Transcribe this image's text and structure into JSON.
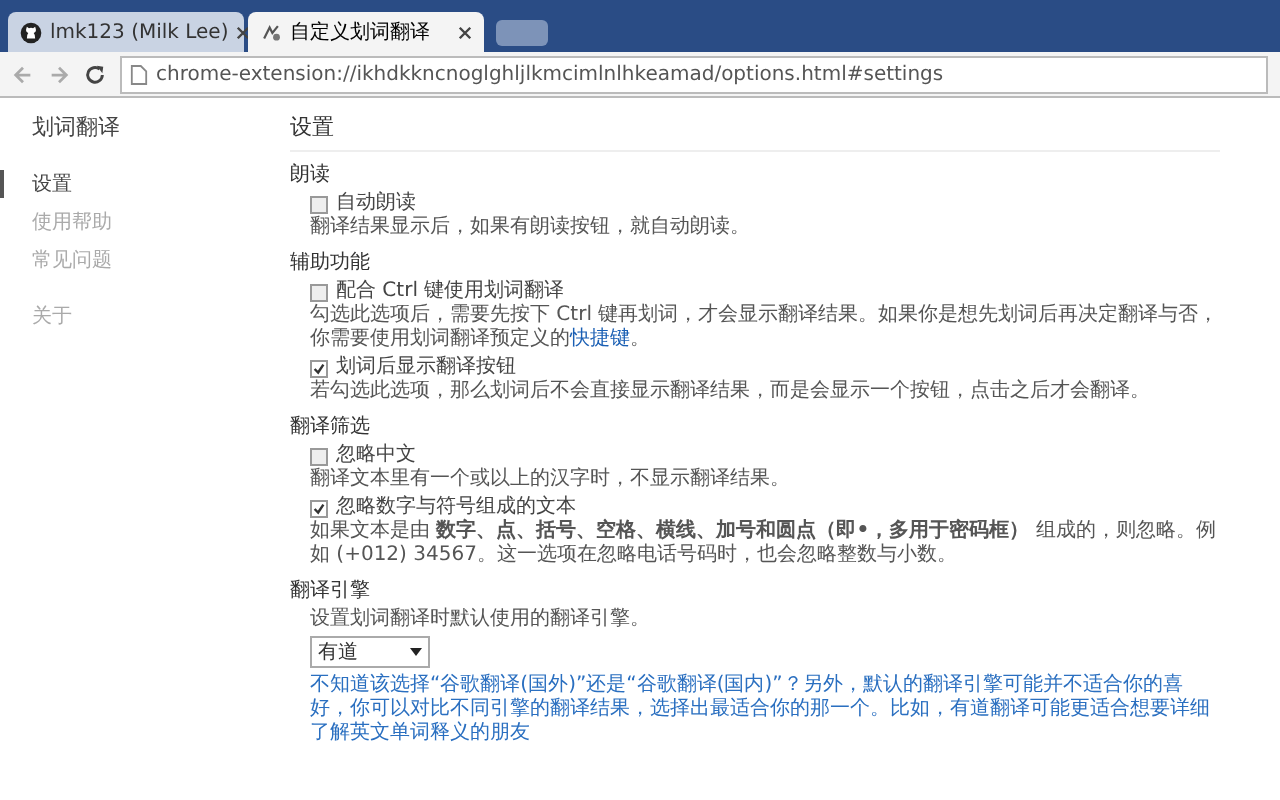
{
  "browser": {
    "tabs": [
      {
        "title": "lmk123 (Milk Lee)",
        "selected": false
      },
      {
        "title": "自定义划词翻译",
        "selected": true
      }
    ],
    "address": "chrome-extension://ikhdkkncnoglghljlkmcimlnlhkeamad/options.html#settings"
  },
  "sidebar": {
    "title": "划词翻译",
    "groups": [
      {
        "items": [
          {
            "label": "设置",
            "selected": true
          },
          {
            "label": "使用帮助",
            "selected": false
          },
          {
            "label": "常见问题",
            "selected": false
          }
        ]
      },
      {
        "items": [
          {
            "label": "关于",
            "selected": false
          }
        ]
      }
    ]
  },
  "page_title": "设置",
  "sections": [
    {
      "heading": "朗读",
      "items": [
        {
          "kind": "checkbox",
          "label": "自动朗读",
          "checked": false
        },
        {
          "kind": "paragraph",
          "text": "翻译结果显示后，如果有朗读按钮，就自动朗读。"
        }
      ]
    },
    {
      "heading": "辅助功能",
      "items": [
        {
          "kind": "checkbox",
          "label": "配合 Ctrl 键使用划词翻译",
          "checked": false
        },
        {
          "kind": "paragraph",
          "text": "勾选此选项后，需要先按下 Ctrl 键再划词，才会显示翻译结果。如果你是想先划词后再决定翻译与否，你需要使用划词翻译预定义的",
          "link": "快捷键",
          "after": "。"
        },
        {
          "kind": "checkbox",
          "label": "划词后显示翻译按钮",
          "checked": true
        },
        {
          "kind": "paragraph",
          "text": "若勾选此选项，那么划词后不会直接显示翻译结果，而是会显示一个按钮，点击之后才会翻译。"
        }
      ]
    },
    {
      "heading": "翻译筛选",
      "items": [
        {
          "kind": "checkbox",
          "label": "忽略中文",
          "checked": false
        },
        {
          "kind": "paragraph",
          "text": "翻译文本里有一个或以上的汉字时，不显示翻译结果。"
        },
        {
          "kind": "checkbox",
          "label": "忽略数字与符号组成的文本",
          "checked": true
        },
        {
          "kind": "paragraph",
          "text": "如果文本是由 **数字、点、括号、空格、横线、加号和圆点（即•，多用于密码框）** 组成的，则忽略。例如 (+012) 34567。这一选项在忽略电话号码时，也会忽略整数与小数。"
        }
      ]
    },
    {
      "heading": "翻译引擎",
      "items": [
        {
          "kind": "paragraph",
          "text": "设置划词翻译时默认使用的翻译引擎。"
        },
        {
          "kind": "select",
          "value": "有道"
        },
        {
          "kind": "note",
          "text": "不知道该选择“谷歌翻译(国外)”还是“谷歌翻译(国内)”？另外，默认的翻译引擎可能并不适合你的喜好，你可以对比不同引擎的翻译结果，选择出最适合你的那一个。比如，有道翻译可能更适合想要详细了解英文单词释义的朋友"
        }
      ]
    }
  ]
}
